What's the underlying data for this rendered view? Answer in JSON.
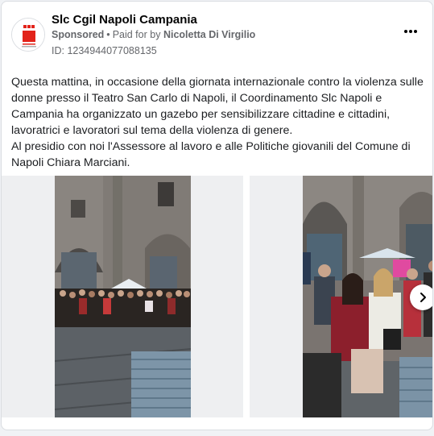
{
  "post": {
    "page_name": "Slc Cgil Napoli Campania",
    "sponsored_label": "Sponsored",
    "separator": "•",
    "paid_for_prefix": "Paid for by",
    "paid_for_name": "Nicoletta Di Virgilio",
    "ad_id": "ID: 1234944077088135",
    "text": "Questa mattina, in occasione della giornata internazionale contro la violenza sulle donne presso il Teatro San Carlo di Napoli, il Coordinamento Slc Napoli e Campania ha organizzato un gazebo per sensibilizzare cittadine e cittadini, lavoratrici e lavoratori sul tema della violenza di genere.\nAl presidio con noi l'Assessore al lavoro e alle Politiche giovanili del Comune di Napoli Chiara Marciani."
  },
  "icons": {
    "more": "more-options-icon",
    "next": "chevron-right-icon",
    "avatar": "slc-cgil-logo"
  },
  "colors": {
    "secondary_text": "#65676b",
    "primary_text": "#050505",
    "logo_red": "#e2231a"
  },
  "carousel": {
    "slides": [
      {
        "alt": "group-photo-in-front-of-teatro-san-carlo"
      },
      {
        "alt": "women-at-gazebo-closeup"
      }
    ]
  }
}
